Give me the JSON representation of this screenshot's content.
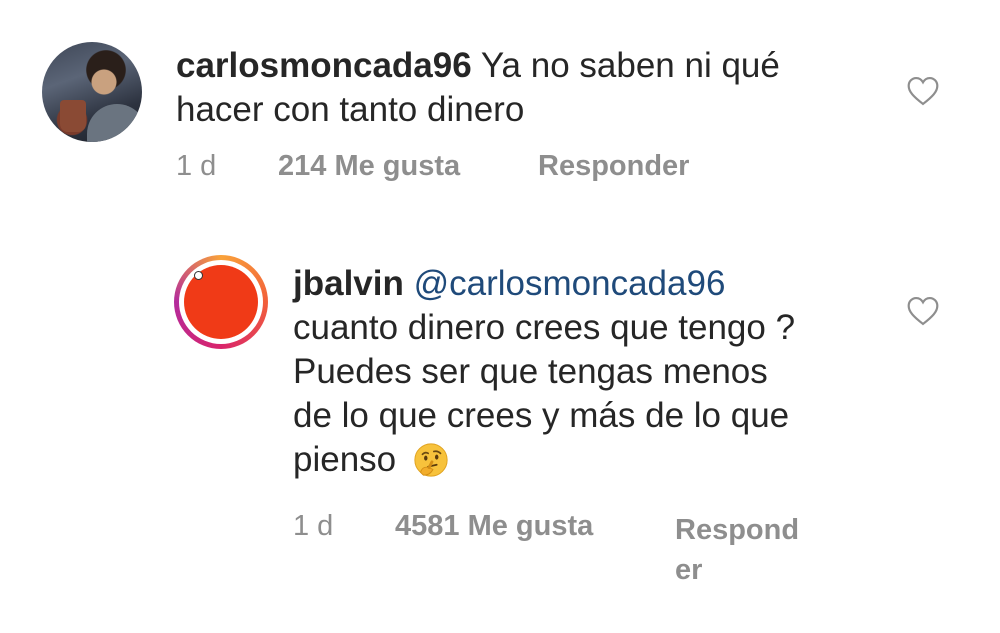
{
  "comments": [
    {
      "username": "carlosmoncada96",
      "text_line1": "Ya no saben ni qué",
      "text_line2": "hacer con tanto dinero",
      "time": "1 d",
      "likes": "214 Me gusta",
      "reply": "Responder",
      "avatar_icon": "profile-photo",
      "like_icon": "heart-outline-icon"
    },
    {
      "username": "jbalvin",
      "mention": "@carlosmoncada96",
      "text_line1": "cuanto dinero crees que tengo ?",
      "text_line2": "Puedes ser que tengas menos",
      "text_line3": "de lo que crees y más de lo que",
      "text_line4": "pienso",
      "emoji": "thinking-face-emoji",
      "time": "1 d",
      "likes": "4581 Me gusta",
      "reply_line1": "Respond",
      "reply_line2": "er",
      "avatar_icon": "story-ring-avatar",
      "like_icon": "heart-outline-icon"
    }
  ],
  "colors": {
    "text": "#262626",
    "meta": "#8e8e8e",
    "mention": "#1f4a7a",
    "avatar_red": "#f03a17"
  }
}
